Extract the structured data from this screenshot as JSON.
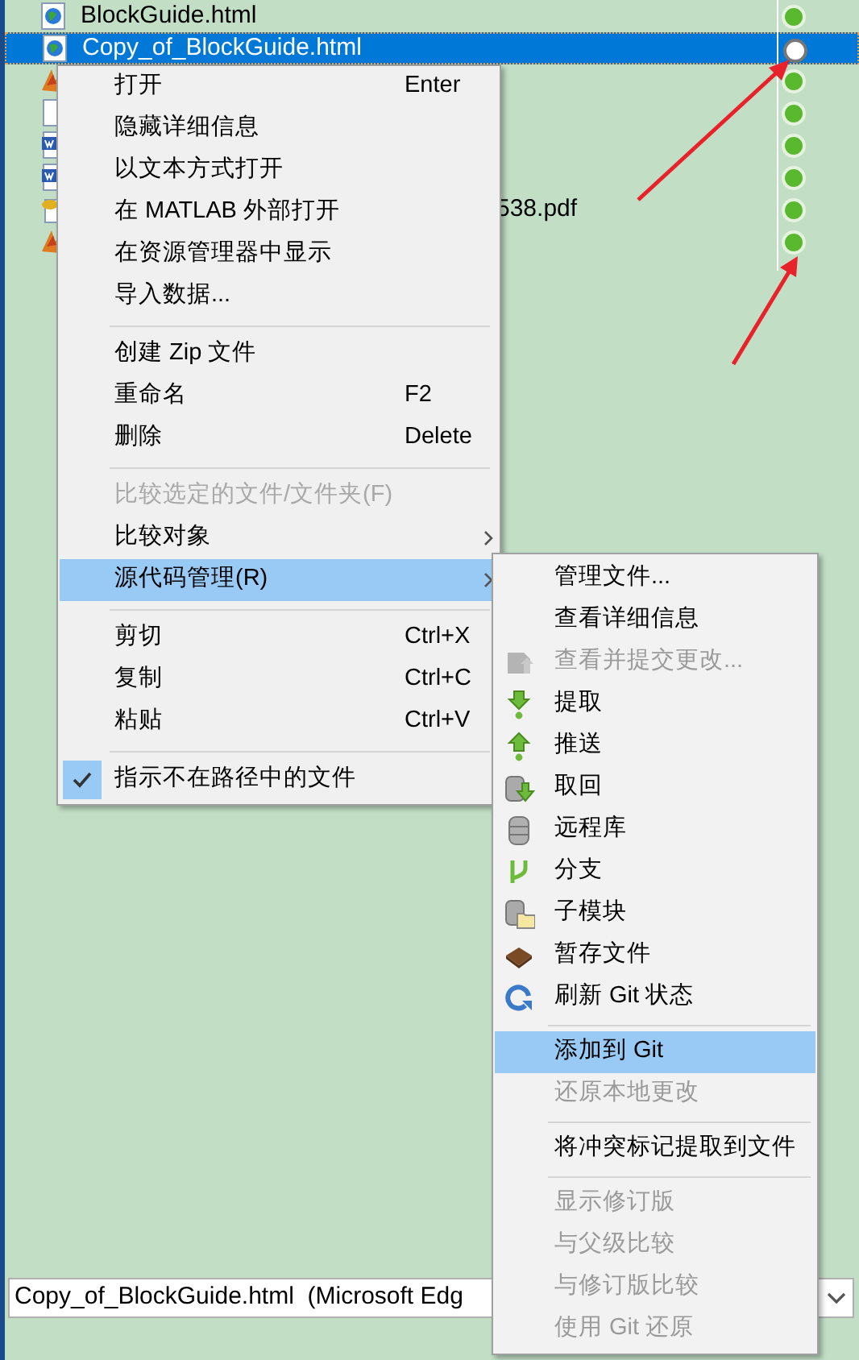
{
  "files": [
    {
      "name": "BlockGuide.html",
      "kind": "web",
      "selected": false,
      "tracked": true
    },
    {
      "name": "Copy_of_BlockGuide.html",
      "kind": "web",
      "selected": true,
      "tracked": false
    },
    {
      "kind": "matlab",
      "selected": false,
      "tracked": true
    },
    {
      "kind": "blank",
      "selected": false,
      "tracked": true
    },
    {
      "kind": "word",
      "selected": false,
      "tracked": true
    },
    {
      "kind": "word",
      "selected": false,
      "tracked": true
    },
    {
      "name": "538.pdf",
      "kind": "pdf",
      "selected": false,
      "tracked": true
    },
    {
      "kind": "matlab",
      "selected": false,
      "tracked": true
    }
  ],
  "context_menu": [
    {
      "kind": "item",
      "label": "打开",
      "shortcut": "Enter",
      "disabled": false,
      "submenu": false,
      "selected": false,
      "checked": false
    },
    {
      "kind": "item",
      "label": "隐藏详细信息",
      "disabled": false,
      "submenu": false,
      "selected": false,
      "checked": false
    },
    {
      "kind": "item",
      "label": "以文本方式打开",
      "disabled": false,
      "submenu": false,
      "selected": false,
      "checked": false
    },
    {
      "kind": "item",
      "label": "在 MATLAB 外部打开",
      "disabled": false,
      "submenu": false,
      "selected": false,
      "checked": false
    },
    {
      "kind": "item",
      "label": "在资源管理器中显示",
      "disabled": false,
      "submenu": false,
      "selected": false,
      "checked": false
    },
    {
      "kind": "item",
      "label": "导入数据...",
      "disabled": false,
      "submenu": false,
      "selected": false,
      "checked": false
    },
    {
      "kind": "separator"
    },
    {
      "kind": "item",
      "label": "创建 Zip 文件",
      "disabled": false,
      "submenu": false,
      "selected": false,
      "checked": false
    },
    {
      "kind": "item",
      "label": "重命名",
      "shortcut": "F2",
      "disabled": false,
      "submenu": false,
      "selected": false,
      "checked": false
    },
    {
      "kind": "item",
      "label": "删除",
      "shortcut": "Delete",
      "disabled": false,
      "submenu": false,
      "selected": false,
      "checked": false
    },
    {
      "kind": "separator"
    },
    {
      "kind": "item",
      "label": "比较选定的文件/文件夹(F)",
      "disabled": true,
      "submenu": false,
      "selected": false,
      "checked": false
    },
    {
      "kind": "item",
      "label": "比较对象",
      "disabled": false,
      "submenu": true,
      "selected": false,
      "checked": false
    },
    {
      "kind": "item",
      "label": "源代码管理(R)",
      "disabled": false,
      "submenu": true,
      "selected": true,
      "checked": false
    },
    {
      "kind": "separator"
    },
    {
      "kind": "item",
      "label": "剪切",
      "shortcut": "Ctrl+X",
      "disabled": false,
      "submenu": false,
      "selected": false,
      "checked": false
    },
    {
      "kind": "item",
      "label": "复制",
      "shortcut": "Ctrl+C",
      "disabled": false,
      "submenu": false,
      "selected": false,
      "checked": false
    },
    {
      "kind": "item",
      "label": "粘贴",
      "shortcut": "Ctrl+V",
      "disabled": false,
      "submenu": false,
      "selected": false,
      "checked": false
    },
    {
      "kind": "separator"
    },
    {
      "kind": "item",
      "label": "指示不在路径中的文件",
      "disabled": false,
      "submenu": false,
      "selected": false,
      "checked": true
    }
  ],
  "source_control_menu": [
    {
      "kind": "item",
      "label": "管理文件...",
      "disabled": false,
      "selected": false
    },
    {
      "kind": "item",
      "label": "查看详细信息",
      "disabled": false,
      "selected": false
    },
    {
      "kind": "commit",
      "label": "查看并提交更改...",
      "disabled": true,
      "selected": false
    },
    {
      "kind": "pull",
      "label": "提取",
      "disabled": false,
      "selected": false
    },
    {
      "kind": "push",
      "label": "推送",
      "disabled": false,
      "selected": false
    },
    {
      "kind": "fetch",
      "label": "取回",
      "disabled": false,
      "selected": false
    },
    {
      "kind": "remote",
      "label": "远程库",
      "disabled": false,
      "selected": false
    },
    {
      "kind": "branch",
      "label": "分支",
      "disabled": false,
      "selected": false
    },
    {
      "kind": "submodule",
      "label": "子模块",
      "disabled": false,
      "selected": false
    },
    {
      "kind": "stash",
      "label": "暂存文件",
      "disabled": false,
      "selected": false
    },
    {
      "kind": "refresh",
      "label": "刷新 Git 状态",
      "disabled": false,
      "selected": false
    },
    {
      "kind": "separator"
    },
    {
      "kind": "item",
      "label": "添加到 Git",
      "disabled": false,
      "selected": true
    },
    {
      "kind": "item",
      "label": "还原本地更改",
      "disabled": true,
      "selected": false
    },
    {
      "kind": "separator"
    },
    {
      "kind": "item",
      "label": "将冲突标记提取到文件",
      "disabled": false,
      "selected": false
    },
    {
      "kind": "separator"
    },
    {
      "kind": "item",
      "label": "显示修订版",
      "disabled": true,
      "selected": false
    },
    {
      "kind": "item",
      "label": "与父级比较",
      "disabled": true,
      "selected": false
    },
    {
      "kind": "item",
      "label": "与修订版比较",
      "disabled": true,
      "selected": false
    },
    {
      "kind": "item",
      "label": "使用 Git 还原",
      "disabled": true,
      "selected": false
    }
  ],
  "file_info_bar": {
    "text": "Copy_of_BlockGuide.html  (Microsoft Edg"
  }
}
